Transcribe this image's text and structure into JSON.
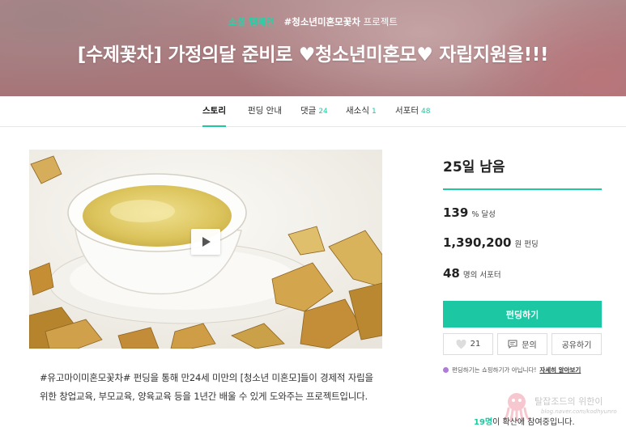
{
  "hero": {
    "category": "소셜 캠페인",
    "project_tag": "#청소년미혼모꽃차",
    "project_suffix": "프로젝트",
    "title": "[수제꽃차] 가정의달 준비로 ♥청소년미혼모♥ 자립지원을!!!"
  },
  "tabs": [
    {
      "label": "스토리",
      "count": ""
    },
    {
      "label": "펀딩 안내",
      "count": ""
    },
    {
      "label": "댓글",
      "count": "24"
    },
    {
      "label": "새소식",
      "count": "1"
    },
    {
      "label": "서포터",
      "count": "48"
    }
  ],
  "description": "#유고마이미혼모꽃차# 펀딩을 통해 만24세 미만의 [청소년 미혼모]들이 경제적 자립을 위한 창업교육, 부모교육, 양육교육 등을 1년간 배울 수 있게 도와주는 프로젝트입니다.",
  "sidebar": {
    "days_left": "25일 남음",
    "achieved": {
      "value": "139",
      "unit": "% 달성"
    },
    "funded": {
      "value": "1,390,200",
      "unit": "원 펀딩"
    },
    "supporters": {
      "value": "48",
      "unit": "명의 서포터"
    },
    "fund_button": "펀딩하기",
    "like_count": "21",
    "inquiry_label": "문의",
    "share_label": "공유하기",
    "note_text": "펀딩하기는 쇼핑하기가 아닙니다!",
    "note_link": "자세히 알아보기",
    "spread_count": "19명",
    "spread_text": "이 확산에 참여중입니다."
  },
  "watermark": {
    "name": "탈잡조드의 위한이",
    "url": "blog.naver.com/kodhyunro"
  },
  "colors": {
    "accent": "#1fc7a0",
    "button": "#1cc7a3",
    "note_dot": "#b07ad9"
  },
  "icons": {
    "like": "heart-icon",
    "inquiry": "message-icon",
    "play": "play-icon"
  }
}
